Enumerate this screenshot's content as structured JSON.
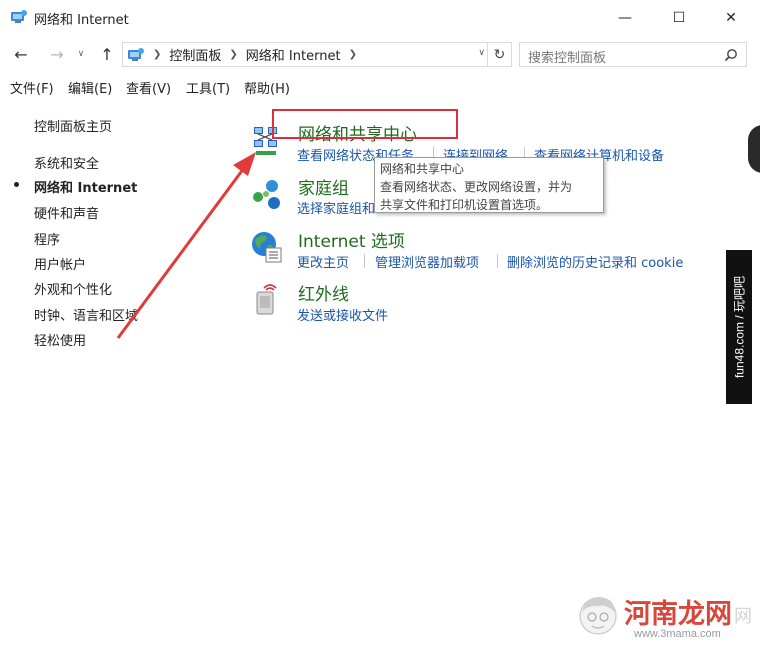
{
  "window": {
    "title": "网络和 Internet",
    "minimize": "—",
    "maximize": "☐",
    "close": "✕"
  },
  "nav": {
    "back": "←",
    "forward": "→",
    "recent": "∨",
    "up": "↑",
    "breadcrumbs": [
      "控制面板",
      "网络和 Internet"
    ],
    "refresh": "↻",
    "search_placeholder": "搜索控制面板"
  },
  "menu": {
    "items": [
      "文件(F)",
      "编辑(E)",
      "查看(V)",
      "工具(T)",
      "帮助(H)"
    ]
  },
  "sidebar": {
    "home": "控制面板主页",
    "items": [
      "系统和安全",
      "网络和 Internet",
      "硬件和声音",
      "程序",
      "用户帐户",
      "外观和个性化",
      "时钟、语言和区域",
      "轻松使用"
    ],
    "active_index": 1
  },
  "categories": [
    {
      "title": "网络和共享中心",
      "icon": "network-sharing-icon",
      "links": [
        "查看网络状态和任务",
        "连接到网络",
        "查看网络计算机和设备"
      ]
    },
    {
      "title": "家庭组",
      "icon": "homegroup-icon",
      "links": [
        "选择家庭组和"
      ]
    },
    {
      "title": "Internet 选项",
      "icon": "internet-options-icon",
      "links": [
        "更改主页",
        "管理浏览器加载项",
        "删除浏览的历史记录和 cookie"
      ]
    },
    {
      "title": "红外线",
      "icon": "infrared-icon",
      "links": [
        "发送或接收文件"
      ]
    }
  ],
  "tooltip": {
    "title": "网络和共享中心",
    "line1": "查看网络状态、更改网络设置，并为",
    "line2": "共享文件和打印机设置首选项。"
  },
  "watermarks": {
    "side": "fun48.com / 玩吧吧",
    "bottom_brand": "河南龙网",
    "bottom_url": "www.3mama.com",
    "bottom_faint": "网"
  },
  "colors": {
    "category_title": "#1f6b1f",
    "link": "#1a56a8",
    "highlight": "#d9303a",
    "arrow": "#e03a3a"
  }
}
